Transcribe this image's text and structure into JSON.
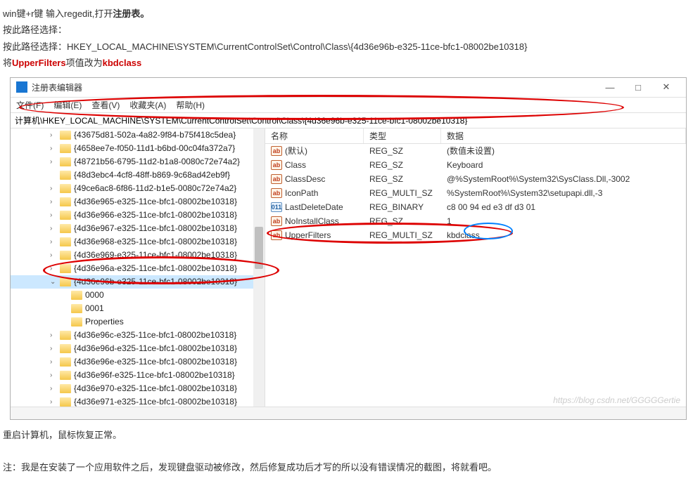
{
  "intro": {
    "line1_prefix": "win键+r键 输入regedit,打开",
    "line1_bold": "注册表。",
    "line2": "按此路径选择：",
    "line3": "按此路径选择：HKEY_LOCAL_MACHINE\\SYSTEM\\CurrentControlSet\\Control\\Class\\{4d36e96b-e325-11ce-bfc1-08002be10318}",
    "line4_prefix": "将",
    "line4_upper": "UpperFilters",
    "line4_mid": "项值改为",
    "line4_kbd": "kbdclass"
  },
  "window": {
    "title": "注册表编辑器",
    "menu": {
      "file": "文件(F)",
      "edit": "编辑(E)",
      "view": "查看(V)",
      "fav": "收藏夹(A)",
      "help": "帮助(H)"
    },
    "address": "计算机\\HKEY_LOCAL_MACHINE\\SYSTEM\\CurrentControlSet\\Control\\Class\\{4d36e96b-e325-11ce-bfc1-08002be10318}",
    "watermark": "https://blog.csdn.net/GGGGGertie"
  },
  "tree": [
    {
      "chev": "›",
      "label": "{43675d81-502a-4a82-9f84-b75f418c5dea}",
      "level": 1
    },
    {
      "chev": "›",
      "label": "{4658ee7e-f050-11d1-b6bd-00c04fa372a7}",
      "level": 1
    },
    {
      "chev": "›",
      "label": "{48721b56-6795-11d2-b1a8-0080c72e74a2}",
      "level": 1
    },
    {
      "chev": "",
      "label": "{48d3ebc4-4cf8-48ff-b869-9c68ad42eb9f}",
      "level": 1
    },
    {
      "chev": "›",
      "label": "{49ce6ac8-6f86-11d2-b1e5-0080c72e74a2}",
      "level": 1
    },
    {
      "chev": "›",
      "label": "{4d36e965-e325-11ce-bfc1-08002be10318}",
      "level": 1
    },
    {
      "chev": "›",
      "label": "{4d36e966-e325-11ce-bfc1-08002be10318}",
      "level": 1
    },
    {
      "chev": "›",
      "label": "{4d36e967-e325-11ce-bfc1-08002be10318}",
      "level": 1
    },
    {
      "chev": "›",
      "label": "{4d36e968-e325-11ce-bfc1-08002be10318}",
      "level": 1
    },
    {
      "chev": "›",
      "label": "{4d36e969-e325-11ce-bfc1-08002be10318}",
      "level": 1
    },
    {
      "chev": "›",
      "label": "{4d36e96a-e325-11ce-bfc1-08002be10318}",
      "level": 1
    },
    {
      "chev": "⌄",
      "label": "{4d36e96b-e325-11ce-bfc1-08002be10318}",
      "level": 1,
      "selected": true
    },
    {
      "chev": "",
      "label": "0000",
      "level": 2
    },
    {
      "chev": "",
      "label": "0001",
      "level": 2
    },
    {
      "chev": "",
      "label": "Properties",
      "level": 2
    },
    {
      "chev": "›",
      "label": "{4d36e96c-e325-11ce-bfc1-08002be10318}",
      "level": 1
    },
    {
      "chev": "›",
      "label": "{4d36e96d-e325-11ce-bfc1-08002be10318}",
      "level": 1
    },
    {
      "chev": "›",
      "label": "{4d36e96e-e325-11ce-bfc1-08002be10318}",
      "level": 1
    },
    {
      "chev": "›",
      "label": "{4d36e96f-e325-11ce-bfc1-08002be10318}",
      "level": 1
    },
    {
      "chev": "›",
      "label": "{4d36e970-e325-11ce-bfc1-08002be10318}",
      "level": 1
    },
    {
      "chev": "›",
      "label": "{4d36e971-e325-11ce-bfc1-08002be10318}",
      "level": 1
    }
  ],
  "list": {
    "headers": {
      "name": "名称",
      "type": "类型",
      "data": "数据"
    },
    "rows": [
      {
        "icon": "ab",
        "name": "(默认)",
        "type": "REG_SZ",
        "data": "(数值未设置)"
      },
      {
        "icon": "ab",
        "name": "Class",
        "type": "REG_SZ",
        "data": "Keyboard"
      },
      {
        "icon": "ab",
        "name": "ClassDesc",
        "type": "REG_SZ",
        "data": "@%SystemRoot%\\System32\\SysClass.Dll,-3002"
      },
      {
        "icon": "ab",
        "name": "IconPath",
        "type": "REG_MULTI_SZ",
        "data": "%SystemRoot%\\System32\\setupapi.dll,-3"
      },
      {
        "icon": "bin",
        "name": "LastDeleteDate",
        "type": "REG_BINARY",
        "data": "c8 00 94 ed e3 df d3 01"
      },
      {
        "icon": "ab",
        "name": "NoInstallClass",
        "type": "REG_SZ",
        "data": "1"
      },
      {
        "icon": "ab",
        "name": "UpperFilters",
        "type": "REG_MULTI_SZ",
        "data": "kbdclass"
      }
    ]
  },
  "outro": {
    "line1": "重启计算机，鼠标恢复正常。",
    "line2": "注：我是在安装了一个应用软件之后，发现键盘驱动被修改，然后修复成功后才写的所以没有错误情况的截图，将就看吧。"
  }
}
